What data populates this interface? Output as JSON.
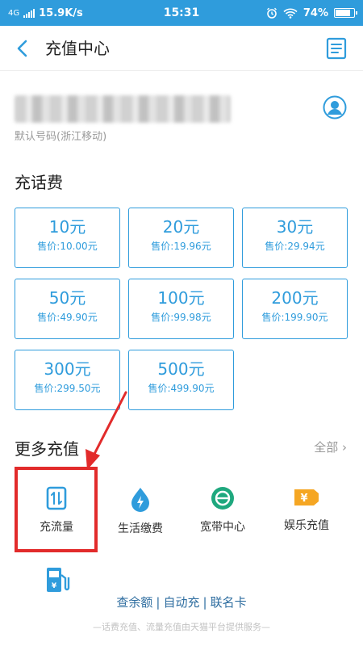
{
  "status_bar": {
    "network": "4G",
    "speed": "15.9K/s",
    "time": "15:31",
    "battery": "74%"
  },
  "header": {
    "title": "充值中心"
  },
  "account": {
    "phone_label": "默认号码(浙江移动)"
  },
  "topup": {
    "title": "充话费",
    "options": [
      {
        "amount": "10元",
        "price": "售价:10.00元"
      },
      {
        "amount": "20元",
        "price": "售价:19.96元"
      },
      {
        "amount": "30元",
        "price": "售价:29.94元"
      },
      {
        "amount": "50元",
        "price": "售价:49.90元"
      },
      {
        "amount": "100元",
        "price": "售价:99.98元"
      },
      {
        "amount": "200元",
        "price": "售价:199.90元"
      },
      {
        "amount": "300元",
        "price": "售价:299.50元"
      },
      {
        "amount": "500元",
        "price": "售价:499.90元"
      }
    ]
  },
  "more": {
    "title": "更多充值",
    "see_all": "全部",
    "items": [
      {
        "label": "充流量",
        "icon": "data-flow-icon"
      },
      {
        "label": "生活缴费",
        "icon": "water-drop-bolt-icon"
      },
      {
        "label": "宽带中心",
        "icon": "broadband-e-icon"
      },
      {
        "label": "娱乐充值",
        "icon": "yuan-ticket-icon"
      }
    ],
    "extra_icon": "fuel-station-icon"
  },
  "links": {
    "balance": "查余额",
    "auto": "自动充",
    "card": "联名卡"
  },
  "footnote": "—话费充值、流量充值由天猫平台提供服务—",
  "colors": {
    "accent": "#2f9cdc",
    "highlight": "#e22b2b"
  }
}
